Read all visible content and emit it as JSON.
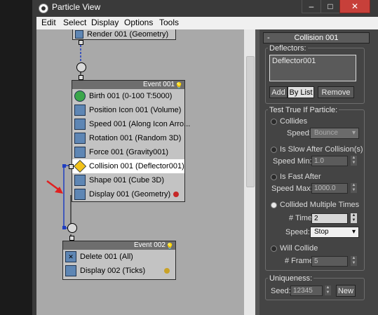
{
  "window": {
    "title": "Particle View",
    "minimize": "–",
    "maximize": "□",
    "close": "✕"
  },
  "menu": [
    "Edit",
    "Select",
    "Display",
    "Options",
    "Tools"
  ],
  "graph": {
    "top_node": {
      "label": "Render 001 (Geometry)"
    },
    "event1": {
      "title": "Event 001",
      "rows": [
        {
          "label": "Birth 001 (0-100 T:5000)",
          "icon": "birth-icon"
        },
        {
          "label": "Position Icon 001 (Volume)",
          "icon": "position-icon"
        },
        {
          "label": "Speed 001 (Along Icon Arro...",
          "icon": "speed-icon"
        },
        {
          "label": "Rotation 001 (Random 3D)",
          "icon": "rotation-icon"
        },
        {
          "label": "Force 001 (Gravity001)",
          "icon": "force-icon"
        },
        {
          "label": "Collision 001 (Deflector001)",
          "icon": "collision-icon",
          "selected": true
        },
        {
          "label": "Shape 001 (Cube 3D)",
          "icon": "shape-icon"
        },
        {
          "label": "Display 001 (Geometry)",
          "icon": "display-icon",
          "dot": "#c62828"
        }
      ]
    },
    "event2": {
      "title": "Event 002",
      "rows": [
        {
          "label": "Delete 001 (All)",
          "icon": "delete-icon"
        },
        {
          "label": "Display 002 (Ticks)",
          "icon": "display-icon",
          "dot": "#c9a227"
        }
      ]
    },
    "annotation_arrow_color": "#e02020",
    "wire_color": "#1f3ec0"
  },
  "panel": {
    "rollout_title": "Collision 001",
    "rollout_toggle": "-",
    "deflectors": {
      "label": "Deflectors:",
      "items": [
        "Deflector001"
      ],
      "add": "Add",
      "by_list": "By List",
      "remove": "Remove"
    },
    "test": {
      "label": "Test True If Particle:",
      "collides": "Collides",
      "speed_label": "Speed:",
      "speed_value": "Bounce",
      "slow": "Is Slow After Collision(s)",
      "speed_min_label": "Speed Min:",
      "speed_min": "1.0",
      "fast": "Is Fast After",
      "speed_max_label": "Speed Max:",
      "speed_max": "1000.0",
      "multiple": "Collided Multiple Times",
      "times_label": "# Times:",
      "times": "2",
      "speed2_label": "Speed:",
      "speed2_value": "Stop",
      "will": "Will Collide",
      "frames_label": "# Frames:",
      "frames": "5"
    },
    "uniqueness": {
      "label": "Uniqueness:",
      "seed_label": "Seed:",
      "seed": "12345",
      "new": "New"
    }
  }
}
